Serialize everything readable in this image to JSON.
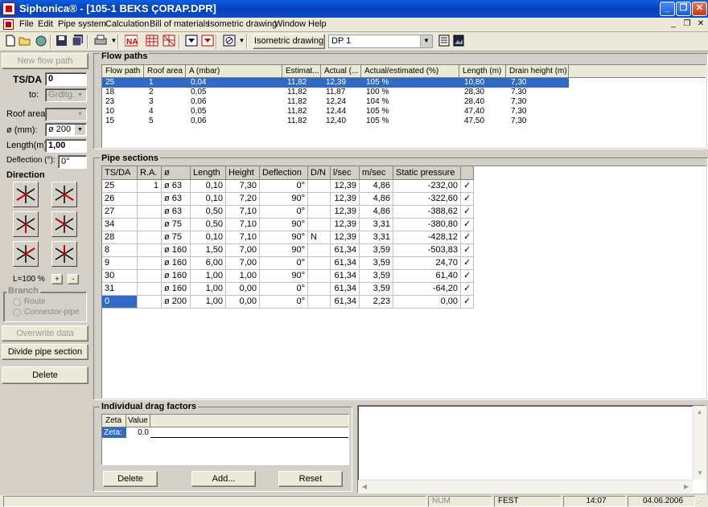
{
  "window": {
    "title": "Siphonica® - [105-1 BEKS ÇORAP.DPR]",
    "minimize": "_",
    "restore": "❐",
    "close": "✕"
  },
  "menu": {
    "items": [
      "File",
      "Edit",
      "Pipe system",
      "Calculation",
      "Bill of materials",
      "Isometric drawing",
      "Window",
      "Help"
    ],
    "mdi_min": "_",
    "mdi_restore": "❐",
    "mdi_close": "✕"
  },
  "toolbar": {
    "isometric_button": "Isometric drawing",
    "dp_value": "DP 1",
    "icons": [
      "new-file-icon",
      "open-folder-icon",
      "project-icon",
      "save-icon",
      "save-all-icon",
      "print-icon",
      "na-icon",
      "grid-red-icon",
      "grid-red2-icon",
      "calc-down-icon",
      "calc-down2-icon",
      "no-entry-icon",
      "list-icon",
      "picture-icon"
    ]
  },
  "left": {
    "new_flow_path": "New flow path",
    "ts_da_label": "TS/DA",
    "ts_da_value": "0",
    "to_label": "to:",
    "to_value": "Grdltg.",
    "roof_area_label": "Roof area:",
    "roof_area_value": "",
    "diameter_label": "ø (mm):",
    "diameter_value": "ø 200",
    "length_label": "Length(m) :",
    "length_value": "1,00",
    "deflection_label": "Deflection (°):",
    "deflection_value": "0°",
    "direction_label": "Direction",
    "l_label": "L=100 %",
    "plus": "+",
    "minus": "-",
    "branch_label": "Branch",
    "route_label": "Route",
    "connector_label": "Connector-pipe",
    "overwrite": "Overwrite data",
    "divide": "Divide pipe section",
    "delete": "Delete"
  },
  "flow_paths": {
    "title": "Flow paths",
    "headers": [
      "Flow path",
      "Roof area",
      "A (mbar)",
      "Estimat...",
      "Actual (...",
      "Actual/estimated (%)",
      "Length (m)",
      "Drain height (m)"
    ],
    "rows": [
      [
        "25",
        "1",
        "0,04",
        "11,82",
        "12,39",
        "105 %",
        "10,80",
        "7,30"
      ],
      [
        "18",
        "2",
        "0,05",
        "11,82",
        "11,87",
        "100 %",
        "28,30",
        "7,30"
      ],
      [
        "23",
        "3",
        "0,06",
        "11,82",
        "12,24",
        "104 %",
        "28,40",
        "7,30"
      ],
      [
        "10",
        "4",
        "0,05",
        "11,82",
        "12,44",
        "105 %",
        "47,40",
        "7,30"
      ],
      [
        "15",
        "5",
        "0,06",
        "11,82",
        "12,40",
        "105 %",
        "47,50",
        "7,30"
      ]
    ]
  },
  "pipe_sections": {
    "title": "Pipe sections",
    "headers": [
      "TS/DA",
      "R.A.",
      "ø",
      "Length",
      "Height",
      "Deflection",
      "D/N",
      "l/sec",
      "m/sec",
      "Static pressure",
      ""
    ],
    "rows": [
      [
        "25",
        "1",
        "ø 63",
        "0,10",
        "7,30",
        "0°",
        "",
        "12,39",
        "4,86",
        "-232,00",
        "✓"
      ],
      [
        "26",
        "",
        "ø 63",
        "0,10",
        "7,20",
        "90°",
        "",
        "12,39",
        "4,86",
        "-322,60",
        "✓"
      ],
      [
        "27",
        "",
        "ø 63",
        "0,50",
        "7,10",
        "0°",
        "",
        "12,39",
        "4,86",
        "-388,62",
        "✓"
      ],
      [
        "34",
        "",
        "ø 75",
        "0,50",
        "7,10",
        "90°",
        "",
        "12,39",
        "3,31",
        "-380,80",
        "✓"
      ],
      [
        "28",
        "",
        "ø 75",
        "0,10",
        "7,10",
        "90°",
        "N",
        "12,39",
        "3,31",
        "-428,12",
        "✓"
      ],
      [
        "8",
        "",
        "ø 160",
        "1,50",
        "7,00",
        "90°",
        "",
        "61,34",
        "3,59",
        "-503,83",
        "✓"
      ],
      [
        "9",
        "",
        "ø 160",
        "6,00",
        "7,00",
        "0°",
        "",
        "61,34",
        "3,59",
        "24,70",
        "✓"
      ],
      [
        "30",
        "",
        "ø 160",
        "1,00",
        "1,00",
        "90°",
        "",
        "61,34",
        "3,59",
        "61,40",
        "✓"
      ],
      [
        "31",
        "",
        "ø 160",
        "1,00",
        "0,00",
        "0°",
        "",
        "61,34",
        "3,59",
        "-64,20",
        "✓"
      ],
      [
        "0",
        "",
        "ø 200",
        "1,00",
        "0,00",
        "0°",
        "",
        "61,34",
        "2,23",
        "0,00",
        "✓"
      ]
    ]
  },
  "drag": {
    "title": "Individual drag factors",
    "headers": [
      "Zeta",
      "Value"
    ],
    "row": [
      "Zeta:",
      "0.0"
    ],
    "delete": "Delete",
    "add": "Add...",
    "reset": "Reset"
  },
  "status": {
    "num": "NUM",
    "fest": "FEST",
    "time": "14:07",
    "date": "04.06.2006"
  },
  "colors": {
    "selection": "#316ac5",
    "titlebar": "#0a5fe0",
    "panel": "#d4d0c8"
  }
}
